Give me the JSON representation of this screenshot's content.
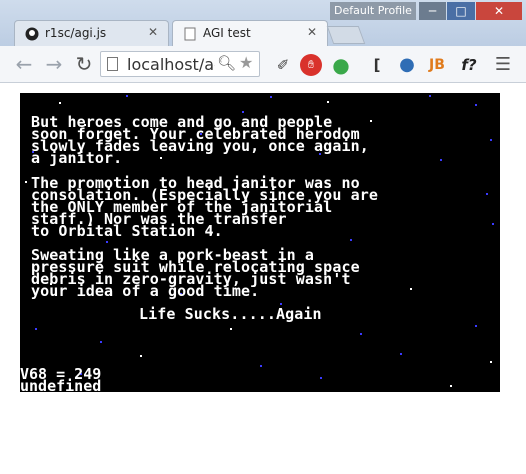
{
  "window": {
    "profile_label": "Default Profile",
    "min_icon": "minimize-icon",
    "max_icon": "maximize-icon",
    "close_icon": "close-icon"
  },
  "tabs": [
    {
      "title": "r1sc/agi.js",
      "icon": "github-icon"
    },
    {
      "title": "AGI test",
      "icon": "page-icon"
    }
  ],
  "toolbar": {
    "url": "localhost/ag",
    "back_icon": "back-arrow-icon",
    "forward_icon": "forward-arrow-icon",
    "reload_icon": "reload-icon",
    "extensions": [
      "eyedropper-icon",
      "stop-icon",
      "drop-icon",
      "bracket-icon",
      "globe-icon",
      "jb-icon",
      "function-icon",
      "menu-icon"
    ]
  },
  "game": {
    "paragraph1": [
      "But heroes come and go and people",
      "soon forget. Your celebrated herodom",
      "slowly fades leaving you, once again,",
      "a janitor."
    ],
    "paragraph2": [
      "The promotion to head janitor was no",
      "consolation. (Especially since you are",
      "the ONLY member of the janitorial",
      "staff.) Nor was the transfer",
      "to Orbital Station 4."
    ],
    "paragraph3": [
      "Sweating like a pork-beast in a",
      "pressure suit while relocating space",
      "debris in zero-gravity, just wasn't",
      "your idea of a good time."
    ],
    "closing": "Life Sucks.....Again",
    "console_line1": "V68 = 249",
    "console_line2": "undefined"
  },
  "colors": {
    "screen_bg": "#000000",
    "text": "#ffffff",
    "star_blue": "#3a3aff",
    "star_white": "#ffffff"
  }
}
